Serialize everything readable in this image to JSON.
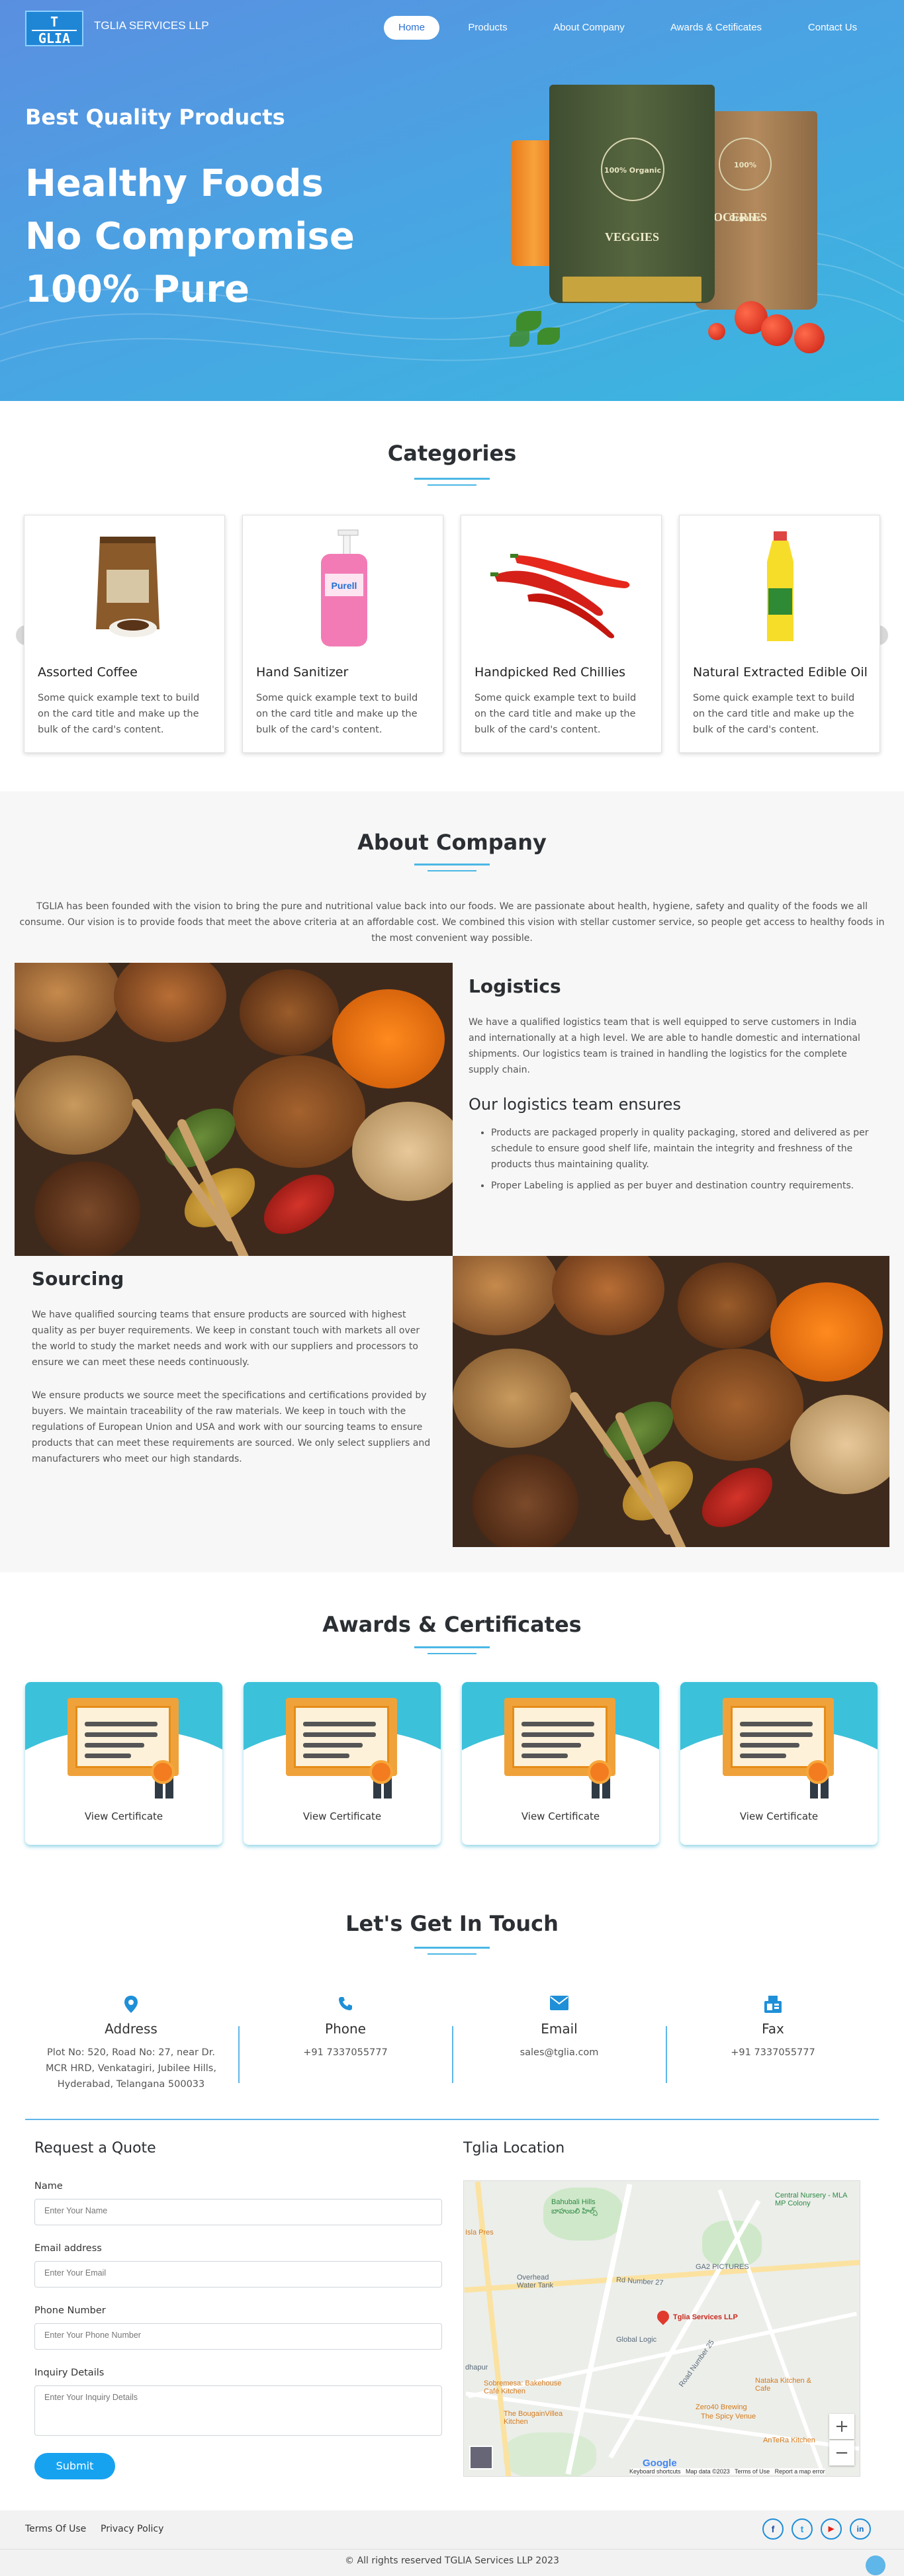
{
  "header": {
    "logo_text_top": "T",
    "logo_text_bottom": "GLIA",
    "brand": "TGLIA SERVICES LLP",
    "nav": [
      "Home",
      "Products",
      "About Company",
      "Awards & Cetificates",
      "Contact Us"
    ]
  },
  "hero": {
    "tagline": "Best Quality Products",
    "lines": [
      "Healthy Foods",
      "No Compromise",
      "100% Pure"
    ],
    "bag1_label": "VEGGIES",
    "bag2_label": "OCERIES",
    "badge_text": "100% Organic"
  },
  "categories": {
    "title": "Categories",
    "cards": [
      {
        "title": "Assorted Coffee",
        "text": "Some quick example text to build on the card title and make up the bulk of the card's content."
      },
      {
        "title": "Hand Sanitizer",
        "text": "Some quick example text to build on the card title and make up the bulk of the card's content."
      },
      {
        "title": "Handpicked Red Chillies",
        "text": "Some quick example text to build on the card title and make up the bulk of the card's content."
      },
      {
        "title": "Natural Extracted Edible Oil",
        "text": "Some quick example text to build on the card title and make up the bulk of the card's content."
      }
    ],
    "prev_icon": "chevron-left-icon",
    "next_icon": "chevron-right-icon"
  },
  "about": {
    "title": "About Company",
    "intro": "TGLIA has been founded with the vision to bring the pure and nutritional value back into our foods. We are passionate about health, hygiene, safety and quality of the foods we all consume. Our vision is to provide foods that meet the above criteria at an affordable cost. We combined this vision with stellar customer service, so people get access to healthy foods in the most convenient way possible.",
    "logistics_title": "Logistics",
    "logistics_text": "We have a qualified logistics team that is well equipped to serve customers in India and internationally at a high level. We are able to handle domestic and international shipments. Our logistics team is trained in handling the logistics for the complete supply chain.",
    "logistics_team_title": "Our logistics team ensures",
    "logistics_points": [
      "Products are packaged properly in quality packaging, stored and delivered as per schedule to ensure good shelf life, maintain the integrity and freshness of the products thus maintaining quality.",
      "Proper Labeling is applied as per buyer and destination country requirements."
    ],
    "sourcing_title": "Sourcing",
    "sourcing_text_1": "We have qualified sourcing teams that ensure products are sourced with highest quality as per buyer requirements. We keep in constant touch with markets all over the world to study the market needs and work with our suppliers and processors to ensure we can meet these needs continuously.",
    "sourcing_text_2": "We ensure products we source meet the specifications and certifications provided by buyers. We maintain traceability of the raw materials. We keep in touch with the regulations of European Union and USA and work with our sourcing teams to ensure products that can meet these requirements are sourced. We only select suppliers and manufacturers who meet our high standards."
  },
  "awards": {
    "title": "Awards & Certificates",
    "items": [
      {
        "label": "View Certificate"
      },
      {
        "label": "View Certificate"
      },
      {
        "label": "View Certificate"
      },
      {
        "label": "View Certificate"
      }
    ]
  },
  "contact": {
    "title": "Let's Get In Touch",
    "columns": [
      {
        "icon": "map-pin-icon",
        "label": "Address",
        "value": "Plot No: 520, Road No: 27, near Dr. MCR HRD, Venkatagiri, Jubilee Hills, Hyderabad, Telangana 500033"
      },
      {
        "icon": "phone-icon",
        "label": "Phone",
        "value": "+91 7337055777"
      },
      {
        "icon": "envelope-icon",
        "label": "Email",
        "value": "sales@tglia.com"
      },
      {
        "icon": "fax-icon",
        "label": "Fax",
        "value": "+91 7337055777"
      }
    ]
  },
  "quote": {
    "title": "Request a Quote",
    "fields": [
      {
        "label": "Name",
        "placeholder": "Enter Your Name"
      },
      {
        "label": "Email address",
        "placeholder": "Enter Your Email"
      },
      {
        "label": "Phone Number",
        "placeholder": "Enter Your Phone Number"
      },
      {
        "label": "Inquiry Details",
        "placeholder": "Enter Your Inquiry Details"
      }
    ],
    "submit": "Submit"
  },
  "location": {
    "title": "Tglia Location",
    "map_labels": {
      "place1": "Bahubali Hills",
      "place1_te": "బాహుబలి హిల్స్",
      "place2": "Central Nursery - MLA MP Colony",
      "place3": "Overhead Water Tank",
      "place4": "GA2 PICTURES",
      "place5": "Global Logic",
      "pin": "Tglia Services LLP",
      "place6": "Sobremesa: Bakehouse Café Kitchen",
      "place7": "The BougainVillea Kitchen",
      "place8": "Nataka Kitchen & Cafe",
      "place9": "Zero40 Brewing",
      "place10": "The Spicy Venue",
      "place11": "AnTeRa Kitchen",
      "place12": "Isla Pres",
      "place13": "dhapur",
      "road1": "Rd Number 27",
      "road2": "Road Number 25",
      "google": "Google",
      "attribution": "Keyboard shortcuts   Map data ©2023   Terms of Use   Report a map error"
    },
    "zoom_in": "+",
    "zoom_out": "−"
  },
  "footer": {
    "links": [
      "Terms Of Use",
      "Privacy Policy"
    ],
    "copyright": "© All rights reserved TGLIA Services LLP 2023",
    "social": [
      {
        "icon": "facebook-icon",
        "glyph": "f",
        "color": "#1f4fa8"
      },
      {
        "icon": "twitter-icon",
        "glyph": "t",
        "color": "#1da1f2"
      },
      {
        "icon": "youtube-icon",
        "glyph": "▶",
        "color": "#e62117"
      },
      {
        "icon": "linkedin-icon",
        "glyph": "in",
        "color": "#0a66c2"
      }
    ]
  },
  "colors": {
    "hero_start": "#5a8fe0",
    "hero_end": "#3ab7df",
    "accent": "#1f8fd8",
    "award_top": "#3cc1da",
    "submit": "#17a2f0"
  }
}
